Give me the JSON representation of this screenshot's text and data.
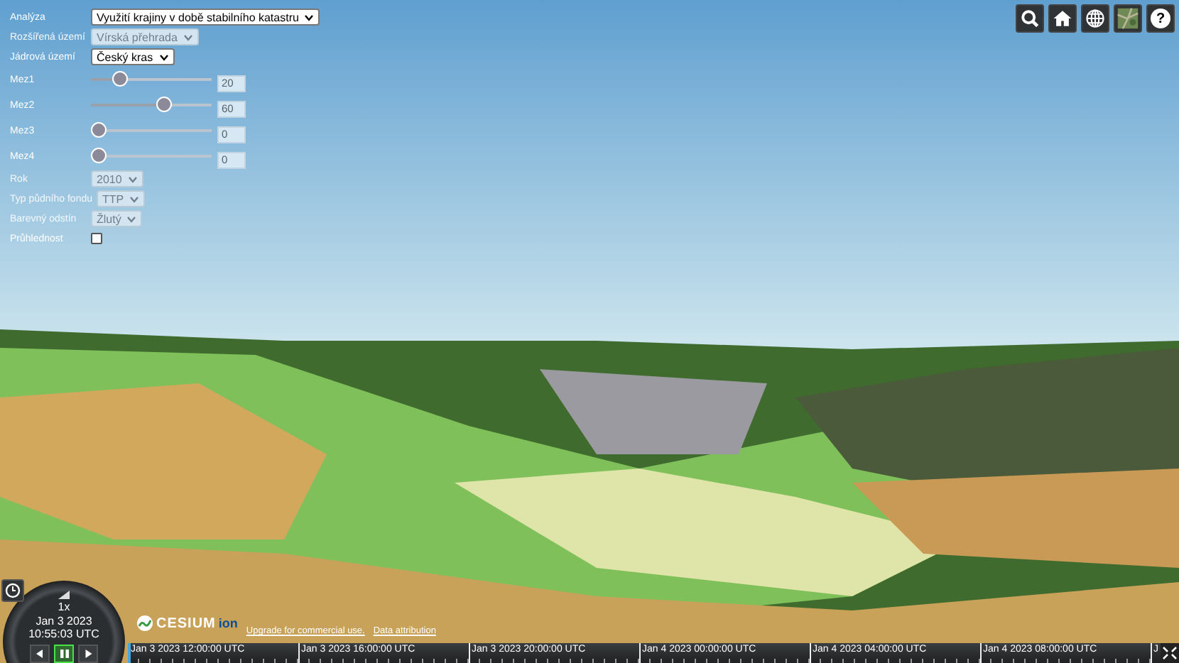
{
  "panel": {
    "controls": [
      {
        "kind": "select",
        "label": "Analýza",
        "value": "Využití krajiny v době stabilního katastru",
        "disabled": false
      },
      {
        "kind": "select",
        "label": "Rozšířená území",
        "value": "Vírská přehrada",
        "disabled": true
      },
      {
        "kind": "select",
        "label": "Jádrová území",
        "value": "Český kras",
        "disabled": false
      },
      {
        "kind": "slider",
        "label": "Mez1",
        "level": 0.2,
        "value": "20"
      },
      {
        "kind": "slider",
        "label": "Mez2",
        "level": 0.6,
        "value": "60"
      },
      {
        "kind": "slider",
        "label": "Mez3",
        "level": 0,
        "value": "0"
      },
      {
        "kind": "slider",
        "label": "Mez4",
        "level": 0,
        "value": "0"
      },
      {
        "kind": "select",
        "label": "Rok",
        "value": "2010",
        "disabled": true
      },
      {
        "kind": "select",
        "label": "Typ půdního fondu",
        "value": "TTP",
        "disabled": true
      },
      {
        "kind": "select",
        "label": "Barevný odstín",
        "value": "Žlutý",
        "disabled": true
      },
      {
        "kind": "checkbox",
        "label": "Průhlednost",
        "checked": false
      }
    ]
  },
  "toolbar": [
    {
      "kind": "search"
    },
    {
      "kind": "home"
    },
    {
      "kind": "globe"
    },
    {
      "kind": "imagery"
    },
    {
      "kind": "help",
      "glyph": "?"
    }
  ],
  "clock": {
    "speed": "1x",
    "date": "Jan 3 2023",
    "time": "10:55:03 UTC",
    "buttons": [
      {
        "kind": "back",
        "selected": false
      },
      {
        "kind": "pause",
        "selected": true
      },
      {
        "kind": "play",
        "selected": false
      }
    ]
  },
  "credits": {
    "logo": "CESIUM",
    "logo_suffix": "ion",
    "links": [
      "Upgrade for commercial use.",
      "Data attribution"
    ]
  },
  "timeline": {
    "labels": [
      "Jan 3 2023 12:00:00 UTC",
      "Jan 3 2023 16:00:00 UTC",
      "Jan 3 2023 20:00:00 UTC",
      "Jan 4 2023 00:00:00 UTC",
      "Jan 4 2023 04:00:00 UTC",
      "Jan 4 2023 08:00:00 UTC",
      "J"
    ]
  }
}
